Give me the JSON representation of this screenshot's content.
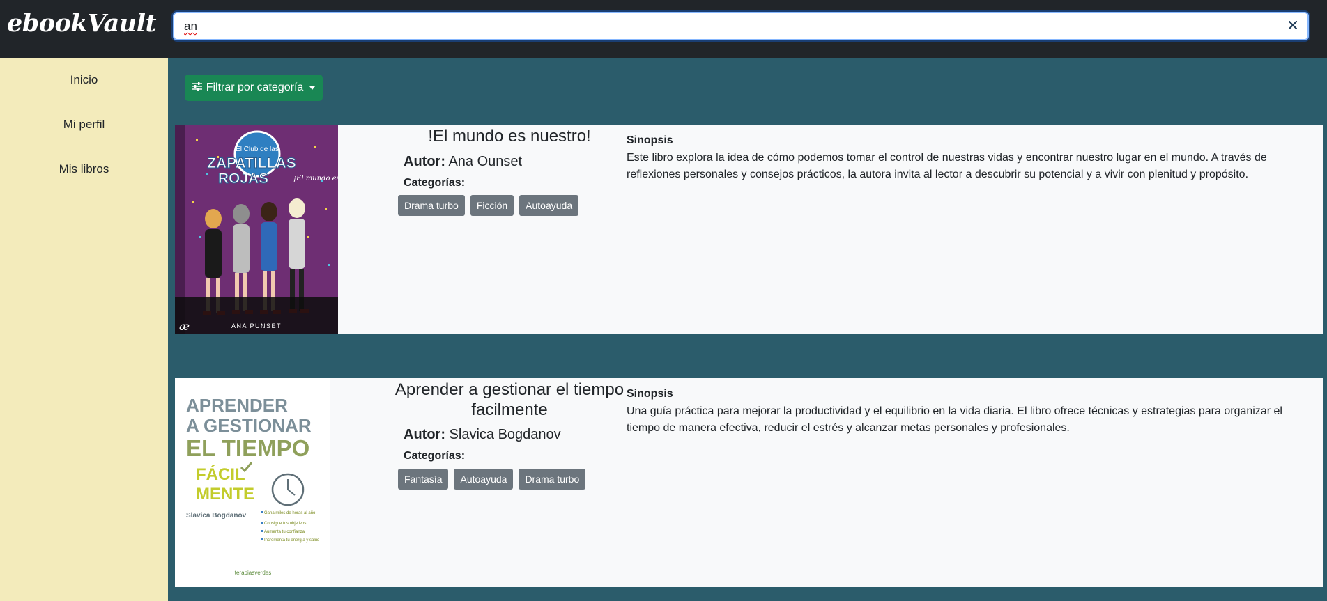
{
  "app": {
    "logo": "ebookVault"
  },
  "search": {
    "value": "an"
  },
  "sidebar": {
    "items": [
      {
        "label": "Inicio"
      },
      {
        "label": "Mi perfil"
      },
      {
        "label": "Mis libros"
      }
    ]
  },
  "filter": {
    "label": "Filtrar por categoría"
  },
  "books": [
    {
      "title": "!El mundo es nuestro!",
      "author_label": "Autor:",
      "author": "Ana Ounset",
      "categories_label": "Categorías:",
      "categories": [
        "Drama turbo",
        "Ficción",
        "Autoayuda"
      ],
      "synopsis_label": "Sinopsis",
      "synopsis": "Este libro explora la idea de cómo podemos tomar el control de nuestras vidas y encontrar nuestro lugar en el mundo. A través de reflexiones personales y consejos prácticos, la autora invita al lector a descubrir su potencial y a vivir con plenitud y propósito.",
      "cover": {
        "series": "El Club de las",
        "title_line1": "ZAPATILLAS",
        "title_line2": "ROJAS",
        "subtitle": "¡El mundo es nuestro!",
        "author": "ANA PUNSET"
      }
    },
    {
      "title": "Aprender a gestionar el tiempo facilmente",
      "author_label": "Autor:",
      "author": "Slavica Bogdanov",
      "categories_label": "Categorías:",
      "categories": [
        "Fantasía",
        "Autoayuda",
        "Drama turbo"
      ],
      "synopsis_label": "Sinopsis",
      "synopsis": "Una guía práctica para mejorar la productividad y el equilibrio en la vida diaria. El libro ofrece técnicas y estrategias para organizar el tiempo de manera efectiva, reducir el estrés y alcanzar metas personales y profesionales.",
      "cover": {
        "line1": "APRENDER",
        "line2": "A GESTIONAR",
        "line3": "EL TIEMPO",
        "line4": "FÁCIL",
        "line5": "MENTE",
        "author": "Slavica Bogdanov",
        "bullets": [
          "Gana miles de horas al año",
          "Consigue tus objetivos",
          "Aumenta tu confianza",
          "Incrementa tu energía y salud"
        ],
        "publisher": "terapiasverdes"
      }
    }
  ]
}
